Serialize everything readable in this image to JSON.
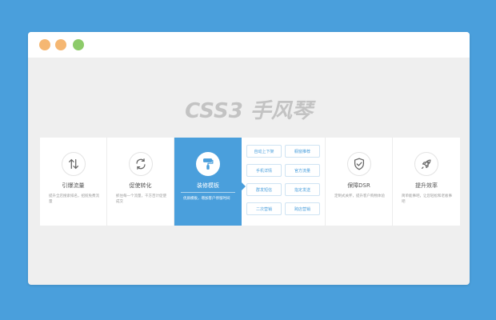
{
  "window": {
    "controls": [
      {
        "name": "close",
        "color": "#f5b772"
      },
      {
        "name": "minimize",
        "color": "#f5b772"
      },
      {
        "name": "maximize",
        "color": "#8dcb6a"
      }
    ]
  },
  "page_title": "CSS3 手风琴",
  "panels": [
    {
      "icon": "up-down-arrows-icon",
      "title": "引爆流量",
      "desc": "提升全店搜索排名，招揽免费流量"
    },
    {
      "icon": "refresh-cycle-icon",
      "title": "促使转化",
      "desc": "抓住每一个流量，千方百计促使成交"
    },
    {
      "icon": "paint-roller-icon",
      "title": "装修模板",
      "desc": "优质模板，增加客户停留时间",
      "active": true
    },
    {
      "icon": "shield-check-icon",
      "title": "保障DSR",
      "desc": "定制式关怀，提升客户购物体验"
    },
    {
      "icon": "rocket-icon",
      "title": "提升效率",
      "desc": "简单能事吧，让您轻松和老板事吧"
    }
  ],
  "tags": [
    "自动上下架",
    "橱窗推荐",
    "手机详情",
    "官方流量",
    "群发短信",
    "指定发送",
    "二次营销",
    "跨店营销"
  ],
  "colors": {
    "accent": "#4a9fdc",
    "background": "#4a9fdc",
    "window": "#efefef"
  }
}
